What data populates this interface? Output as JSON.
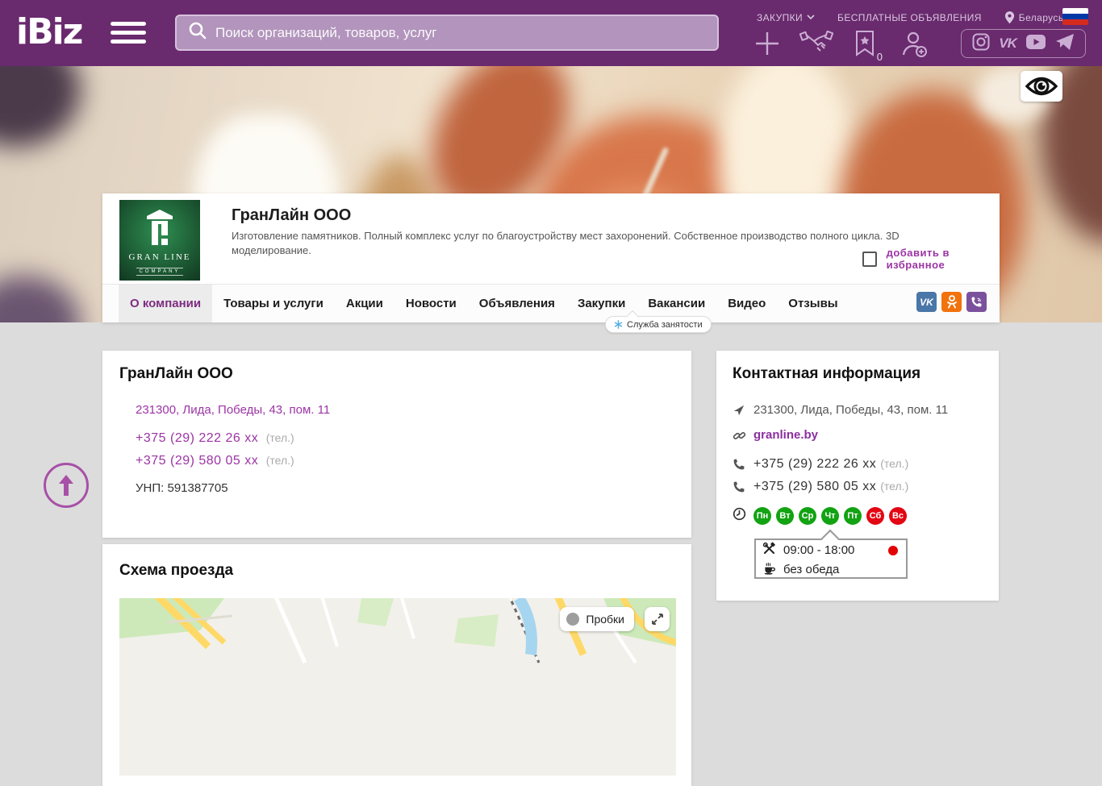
{
  "header": {
    "logo_text": "iBiz",
    "search_placeholder": "Поиск организаций, товаров, услуг",
    "menu_zakupki": "ЗАКУПКИ",
    "menu_free_ads": "БЕСПЛАТНЫЕ ОБЪЯВЛЕНИЯ",
    "country": "Беларусь",
    "favorites_count": "0",
    "vk_label": "VK"
  },
  "company_card": {
    "name": "ГранЛайн ООО",
    "description": "Изготовление памятников. Полный комплекс услуг по благоустройству мест захоронений. Собственное производство полного цикла. 3D моделирование.",
    "favorite_label": "добавить в избранное",
    "logo": {
      "line1": "GRAN LINE",
      "line2": "COMPANY"
    },
    "tabs": [
      {
        "label": "О компании",
        "active": true
      },
      {
        "label": "Товары и услуги"
      },
      {
        "label": "Акции"
      },
      {
        "label": "Новости"
      },
      {
        "label": "Объявления"
      },
      {
        "label": "Закупки"
      },
      {
        "label": "Вакансии"
      },
      {
        "label": "Видео"
      },
      {
        "label": "Отзывы"
      }
    ],
    "vacancies_tooltip": "Служба занятости",
    "social": {
      "vk": "VK"
    }
  },
  "about_card": {
    "title": "ГранЛайн ООО",
    "address": "231300, Лида, Победы, 43, пом. 11",
    "phone1": "+375 (29) 222 26 xx",
    "phone1_note": "(тел.)",
    "phone2": "+375 (29) 580 05 xx",
    "phone2_note": "(тел.)",
    "unp": "УНП: 591387705"
  },
  "map_card": {
    "title": "Схема проезда",
    "traffic_button": "Пробки"
  },
  "contacts_card": {
    "title": "Контактная информация",
    "address": "231300, Лида, Победы, 43, пом. 11",
    "website": "granline.by",
    "phone1": "+375 (29) 222 26 xx",
    "phone1_note": "(тел.)",
    "phone2": "+375 (29) 580 05 xx",
    "phone2_note": "(тел.)",
    "days": [
      {
        "label": "Пн",
        "status": "open"
      },
      {
        "label": "Вт",
        "status": "open"
      },
      {
        "label": "Ср",
        "status": "open"
      },
      {
        "label": "Чт",
        "status": "open"
      },
      {
        "label": "Пт",
        "status": "open"
      },
      {
        "label": "Сб",
        "status": "closed"
      },
      {
        "label": "Вс",
        "status": "closed"
      }
    ],
    "schedule_hours": "09:00 - 18:00",
    "schedule_lunch": "без обеда"
  },
  "colors": {
    "header_purple": "#692a6e",
    "accent_purple": "#9c34a5",
    "open_green": "#12a312",
    "closed_red": "#e30613",
    "vk_blue": "#4a76a8",
    "ok_orange": "#f2720c",
    "viber_purple": "#7b519d"
  }
}
